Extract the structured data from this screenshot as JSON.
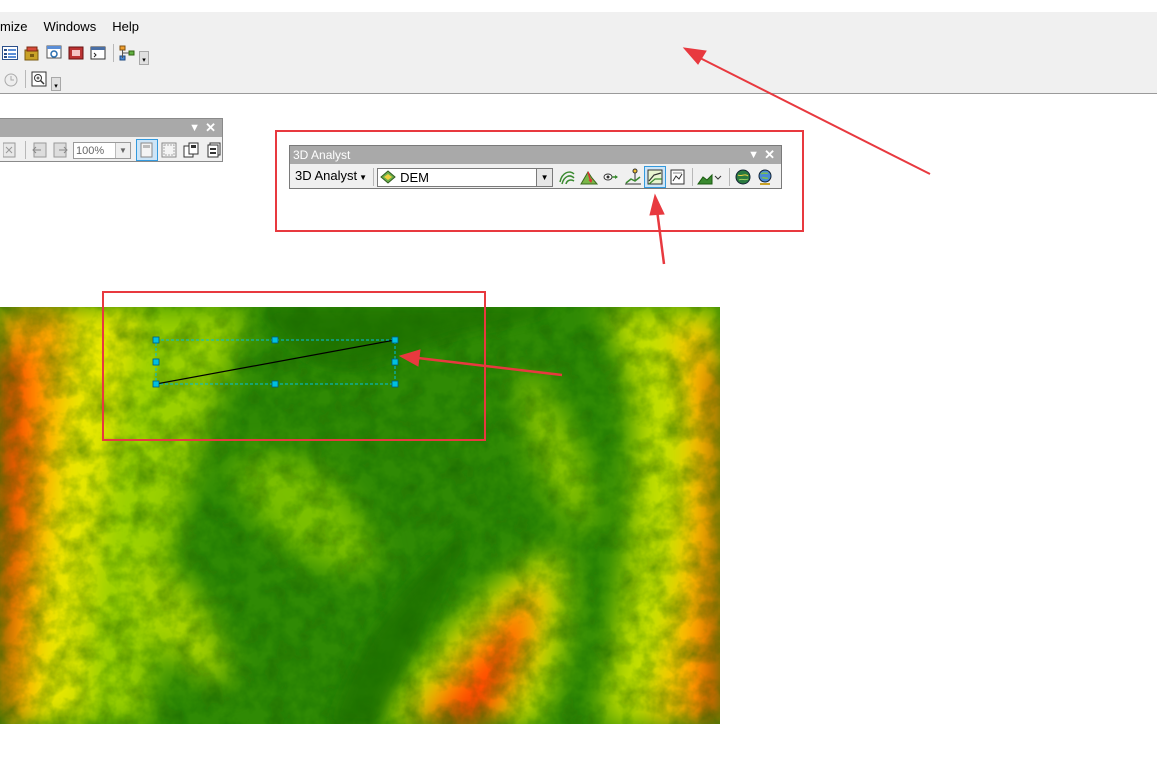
{
  "menubar": {
    "items": [
      "mize",
      "Windows",
      "Help"
    ]
  },
  "toolbar_rows": {
    "row1_icons": [
      "catalog-window-icon",
      "arctoolbox-icon",
      "search-window-icon",
      "model-builder-icon",
      "python-window-icon",
      "hierarchy-tool-icon"
    ],
    "row2_icons": [
      "time-slider-icon",
      "full-extent-icon"
    ]
  },
  "layout_toolbar": {
    "zoom_percent": "100%"
  },
  "analyst_toolbar": {
    "title": "3D Analyst",
    "menu_label": "3D Analyst",
    "layer_value": "DEM",
    "icons": [
      "contour-icon",
      "steepest-path-icon",
      "line-of-sight-icon",
      "point-profile-icon",
      "interpolate-line-icon",
      "profile-graph-icon",
      "terrain-icon",
      "arcscene-icon",
      "arcglobe-icon"
    ]
  },
  "colors": {
    "annotation_red": "#e8393f",
    "selection_cyan": "#00c0e0",
    "dem_low": "#1a7a00",
    "dem_mid": "#d8e800",
    "dem_high": "#ff3000"
  }
}
